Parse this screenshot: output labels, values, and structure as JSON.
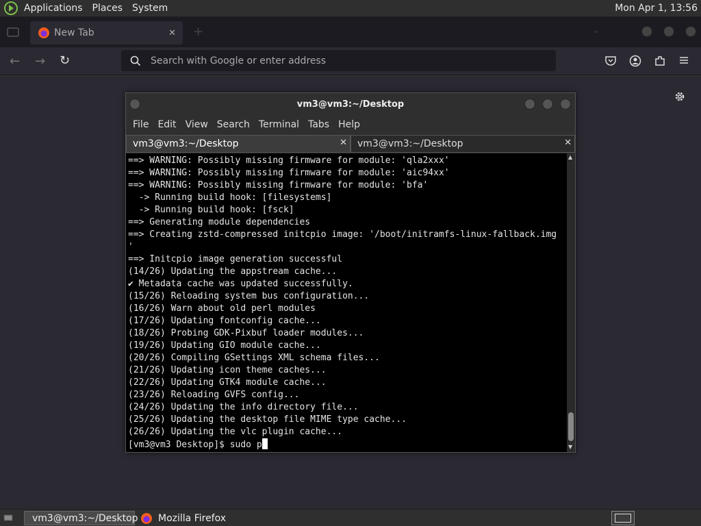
{
  "top_panel": {
    "menus": [
      "Applications",
      "Places",
      "System"
    ],
    "clock": "Mon Apr 1, 13:56"
  },
  "firefox": {
    "tab_title": "New Tab",
    "url_placeholder": "Search with Google or enter address"
  },
  "terminal": {
    "title": "vm3@vm3:~/Desktop",
    "menus": [
      "File",
      "Edit",
      "View",
      "Search",
      "Terminal",
      "Tabs",
      "Help"
    ],
    "tabs": [
      {
        "label": "vm3@vm3:~/Desktop"
      },
      {
        "label": "vm3@vm3:~/Desktop"
      }
    ],
    "lines": [
      "==> WARNING: Possibly missing firmware for module: 'qla2xxx'",
      "==> WARNING: Possibly missing firmware for module: 'aic94xx'",
      "==> WARNING: Possibly missing firmware for module: 'bfa'",
      "  -> Running build hook: [filesystems]",
      "  -> Running build hook: [fsck]",
      "==> Generating module dependencies",
      "==> Creating zstd-compressed initcpio image: '/boot/initramfs-linux-fallback.img",
      "'",
      "==> Initcpio image generation successful",
      "(14/26) Updating the appstream cache...",
      "✔ Metadata cache was updated successfully.",
      "(15/26) Reloading system bus configuration...",
      "(16/26) Warn about old perl modules",
      "(17/26) Updating fontconfig cache...",
      "(18/26) Probing GDK-Pixbuf loader modules...",
      "(19/26) Updating GIO module cache...",
      "(20/26) Compiling GSettings XML schema files...",
      "(21/26) Updating icon theme caches...",
      "(22/26) Updating GTK4 module cache...",
      "(23/26) Reloading GVFS config...",
      "(24/26) Updating the info directory file...",
      "(25/26) Updating the desktop file MIME type cache...",
      "(26/26) Updating the vlc plugin cache..."
    ],
    "prompt": "[vm3@vm3 Desktop]$ sudo p"
  },
  "taskbar": {
    "items": [
      {
        "label": "vm3@vm3:~/Desktop"
      },
      {
        "label": "Mozilla Firefox"
      }
    ]
  }
}
